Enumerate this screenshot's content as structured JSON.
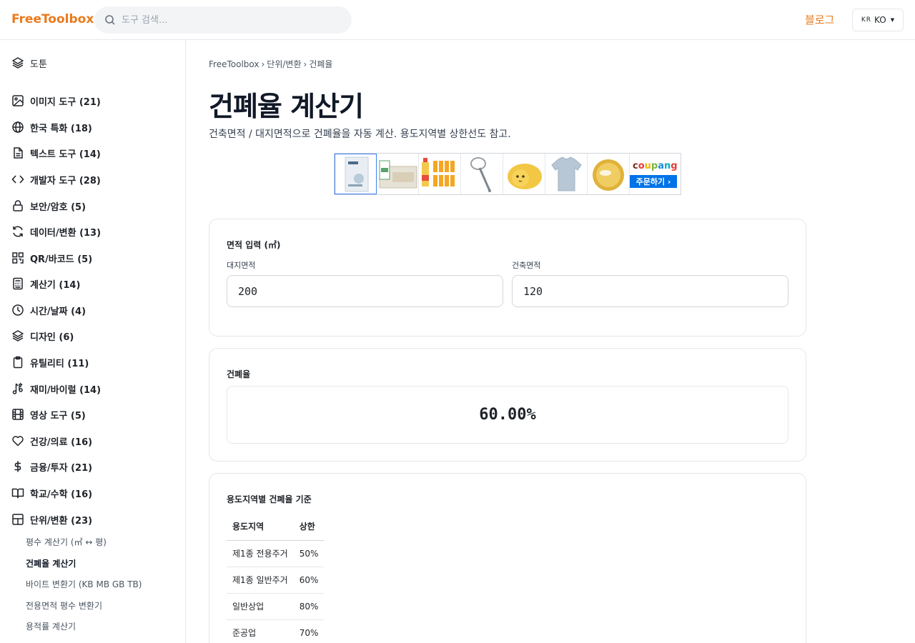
{
  "header": {
    "logo": "FreeToolbox",
    "search_placeholder": "도구 검색...",
    "blog_label": "블로그",
    "lang_flag": "KR",
    "lang_label": "KO"
  },
  "sidebar": {
    "top_item": "도툰",
    "categories": [
      {
        "label": "이미지 도구 (21)",
        "icon": "image-icon"
      },
      {
        "label": "한국 특화 (18)",
        "icon": "globe-icon"
      },
      {
        "label": "텍스트 도구 (14)",
        "icon": "file-text-icon"
      },
      {
        "label": "개발자 도구 (28)",
        "icon": "code-icon"
      },
      {
        "label": "보안/암호 (5)",
        "icon": "lock-icon"
      },
      {
        "label": "데이터/변환 (13)",
        "icon": "refresh-icon"
      },
      {
        "label": "QR/바코드 (5)",
        "icon": "qr-icon"
      },
      {
        "label": "계산기 (14)",
        "icon": "calculator-icon"
      },
      {
        "label": "시간/날짜 (4)",
        "icon": "clock-icon"
      },
      {
        "label": "디자인 (6)",
        "icon": "layers-icon"
      },
      {
        "label": "유틸리티 (11)",
        "icon": "clipboard-icon"
      },
      {
        "label": "재미/바이럴 (14)",
        "icon": "music-icon"
      },
      {
        "label": "영상 도구 (5)",
        "icon": "film-icon"
      },
      {
        "label": "건강/의료 (16)",
        "icon": "heart-icon"
      },
      {
        "label": "금융/투자 (21)",
        "icon": "dollar-icon"
      },
      {
        "label": "학교/수학 (16)",
        "icon": "book-icon"
      },
      {
        "label": "단위/변환 (23)",
        "icon": "grid-icon"
      }
    ],
    "sub_items": [
      {
        "label": "평수 계산기 (㎡ ↔ 평)",
        "active": false
      },
      {
        "label": "건폐율 계산기",
        "active": true
      },
      {
        "label": "바이트 변환기 (KB MB GB TB)",
        "active": false
      },
      {
        "label": "전용면적 평수 변환기",
        "active": false
      },
      {
        "label": "용적률 계산기",
        "active": false
      }
    ]
  },
  "breadcrumb": [
    "FreeToolbox",
    "단위/변환",
    "건폐율"
  ],
  "page": {
    "title": "건폐율 계산기",
    "description": "건축면적 / 대지면적으로 건폐율을 자동 계산. 용도지역별 상한선도 참고."
  },
  "ad": {
    "brand": "coupang",
    "cta": "주문하기 ›"
  },
  "input_card": {
    "title": "면적 입력 (㎡)",
    "land_label": "대지면적",
    "land_value": "200",
    "building_label": "건축면적",
    "building_value": "120"
  },
  "result_card": {
    "title": "건폐율",
    "value": "60.00%"
  },
  "zone_card": {
    "title": "용도지역별 건폐율 기준",
    "headers": [
      "용도지역",
      "상한"
    ],
    "rows": [
      [
        "제1종 전용주거",
        "50%"
      ],
      [
        "제1종 일반주거",
        "60%"
      ],
      [
        "일반상업",
        "80%"
      ],
      [
        "준공업",
        "70%"
      ]
    ]
  },
  "colors": {
    "accent": "#ea7a1c",
    "coupang_blue": "#0073e9"
  }
}
